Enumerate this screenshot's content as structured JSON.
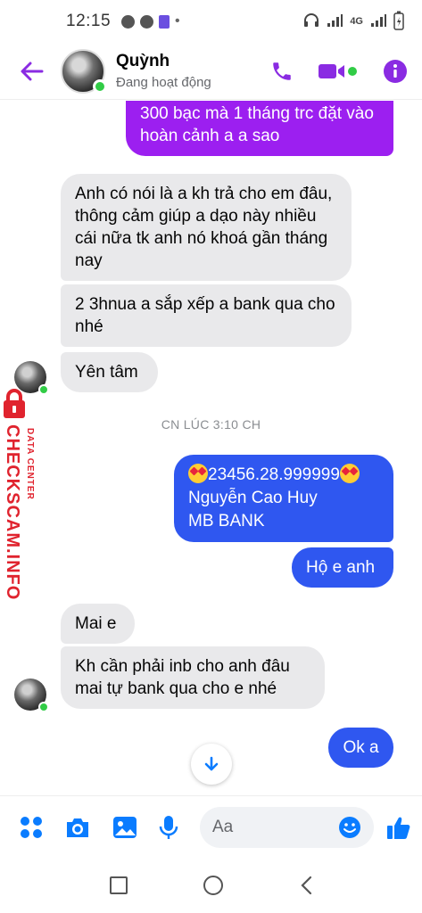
{
  "status_bar": {
    "time": "12:15",
    "network": "4G"
  },
  "header": {
    "contact_name": "Quỳnh",
    "contact_status": "Đang hoạt động"
  },
  "messages": [
    {
      "text": "300 bạc mà 1 tháng trc đặt vào hoàn cảnh a a sao"
    },
    {
      "text": "Anh có nói là a kh trả cho em đâu, thông cảm giúp a dạo này nhiều cái nữa tk anh nó khoá gần tháng nay"
    },
    {
      "text": "2 3hnua a sắp xếp a bank qua cho nhé"
    },
    {
      "text": "Yên tâm"
    },
    {
      "text": "23456.28.999999",
      "line2": "Nguyễn Cao Huy",
      "line3": "MB BANK"
    },
    {
      "text": "Hộ e anh"
    },
    {
      "text": "Mai e"
    },
    {
      "text": "Kh cần phải inb cho anh đâu mai tự bank qua cho e nhé"
    },
    {
      "text": "Ok a"
    }
  ],
  "timestamp": "CN LÚC 3:10 CH",
  "composer": {
    "placeholder": "Aa"
  },
  "watermark": {
    "title": "CHECKSCAM.INFO",
    "subtitle": "DATA CENTER"
  },
  "colors": {
    "accent": "#8a2be2",
    "purple_bubble": "#9c1ff0",
    "blue_bubble": "#2f57f0",
    "composer_icon": "#0a7cff",
    "online": "#31cc46",
    "watermark": "#e0232e"
  },
  "icons": [
    "back-arrow-icon",
    "phone-icon",
    "video-icon",
    "info-icon",
    "apps-icon",
    "camera-icon",
    "gallery-icon",
    "mic-icon",
    "emoji-icon",
    "like-icon",
    "scroll-down-icon"
  ]
}
